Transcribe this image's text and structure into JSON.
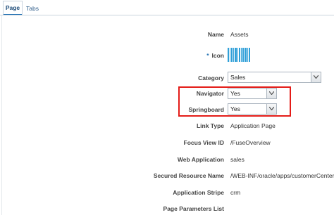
{
  "tabs": {
    "page": "Page",
    "tabs": "Tabs"
  },
  "form": {
    "name_label": "Name",
    "name_value": "Assets",
    "icon_label": "Icon",
    "icon_required": "*",
    "category_label": "Category",
    "category_value": "Sales",
    "navigator_label": "Navigator",
    "navigator_value": "Yes",
    "springboard_label": "Springboard",
    "springboard_value": "Yes",
    "link_type_label": "Link Type",
    "link_type_value": "Application Page",
    "focus_view_label": "Focus View ID",
    "focus_view_value": "/FuseOverview",
    "web_app_label": "Web Application",
    "web_app_value": "sales",
    "secured_label": "Secured Resource Name",
    "secured_value": "/WEB-INF/oracle/apps/customerCenter/infra",
    "stripe_label": "Application Stripe",
    "stripe_value": "crm",
    "params_label": "Page Parameters List"
  },
  "colors": {
    "accent": "#1f6fb2",
    "highlight": "#e41b17",
    "icon": "#2f9fd8"
  }
}
